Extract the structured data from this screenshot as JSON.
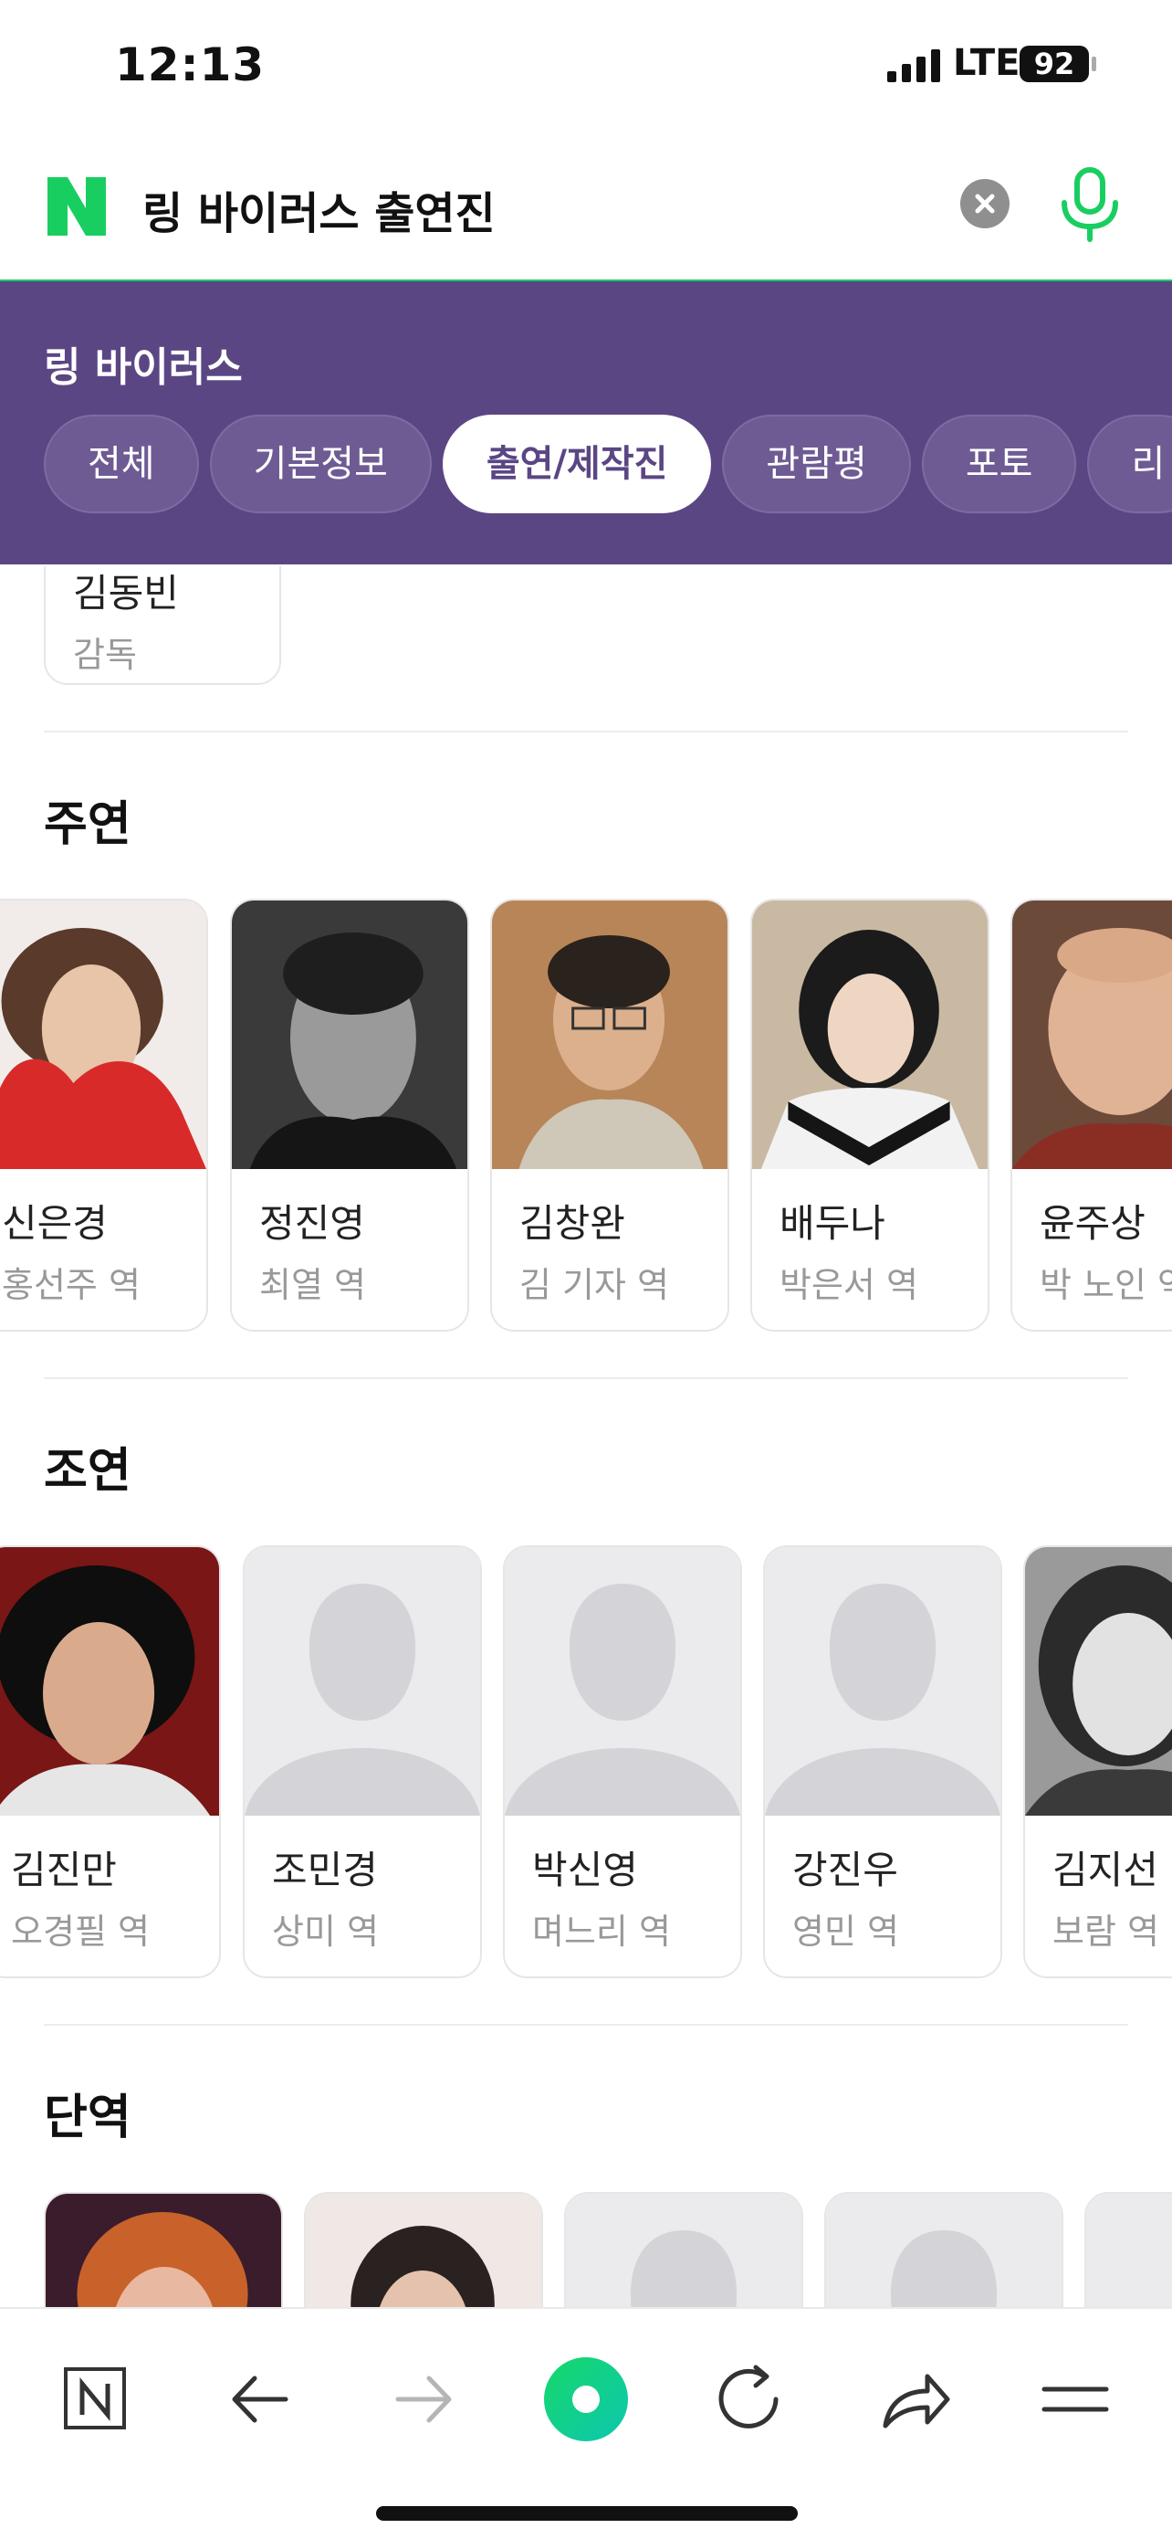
{
  "status_bar": {
    "time": "12:13",
    "network": "LTE",
    "battery": "92"
  },
  "search": {
    "query": "링 바이러스 출연진"
  },
  "header": {
    "movie_title": "링 바이러스",
    "tabs": [
      {
        "label": "전체"
      },
      {
        "label": "기본정보"
      },
      {
        "label": "출연/제작진",
        "active": true
      },
      {
        "label": "관람평"
      },
      {
        "label": "포토"
      },
      {
        "label": "리"
      }
    ]
  },
  "director": {
    "name": "김동빈",
    "role": "감독"
  },
  "sections": {
    "lead": {
      "title": "주연",
      "cast": [
        {
          "name": "신은경",
          "role": "홍선주 역",
          "photo": "photo"
        },
        {
          "name": "정진영",
          "role": "최열 역",
          "photo": "photo"
        },
        {
          "name": "김창완",
          "role": "김 기자 역",
          "photo": "photo"
        },
        {
          "name": "배두나",
          "role": "박은서 역",
          "photo": "photo"
        },
        {
          "name": "윤주상",
          "role": "박 노인 역",
          "photo": "photo"
        }
      ]
    },
    "supporting": {
      "title": "조연",
      "cast": [
        {
          "name": "김진만",
          "role": "오경필 역",
          "photo": "photo"
        },
        {
          "name": "조민경",
          "role": "상미 역",
          "photo": "placeholder"
        },
        {
          "name": "박신영",
          "role": "며느리 역",
          "photo": "placeholder"
        },
        {
          "name": "강진우",
          "role": "영민 역",
          "photo": "placeholder"
        },
        {
          "name": "김지선",
          "role": "보람 역",
          "photo": "photo"
        }
      ]
    },
    "cameo": {
      "title": "단역"
    }
  },
  "bottom_nav": [
    "naver-home-icon",
    "back-arrow-icon",
    "forward-arrow-icon",
    "green-dot-icon",
    "refresh-icon",
    "share-icon",
    "menu-icon"
  ],
  "colors": {
    "accent_green": "#19ce60",
    "header_purple": "#5b4684"
  }
}
